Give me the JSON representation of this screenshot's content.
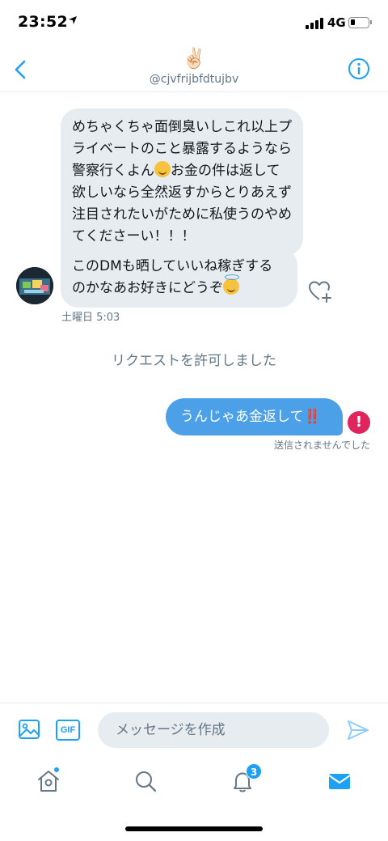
{
  "status": {
    "time": "23:52",
    "network": "4G"
  },
  "header": {
    "emoji": "✌🏻",
    "handle": "@cjvfrijbfdtujbv"
  },
  "messages": {
    "incoming_1": {
      "text_a": "めちゃくちゃ面倒臭いしこれ以上プライベートのこと暴露するようなら警察行くよん",
      "text_b": "お金の件は返して欲しいなら全然返すからとりあえず注目されたいがために私使うのやめてくださーい！！！"
    },
    "incoming_2": {
      "text": "このDMも晒していいね稼ぎするのかなあお好きにどうぞ"
    },
    "incoming_time": "土曜日 5:03",
    "system_notice": "リクエストを許可しました",
    "outgoing": {
      "text": "うんじゃあ金返して",
      "emoji": "‼️",
      "status": "送信されませんでした"
    }
  },
  "compose": {
    "gif_label": "GIF",
    "placeholder": "メッセージを作成"
  },
  "tabs": {
    "notifications_badge": "3"
  },
  "colors": {
    "accent": "#1da1f2",
    "bubble_out": "#4ba0e8",
    "bubble_in": "#e6ecf0",
    "error": "#e0245e"
  },
  "icons": [
    "back-arrow-icon",
    "info-icon",
    "heart-plus-icon",
    "error-icon",
    "image-icon",
    "gif-icon",
    "send-icon",
    "home-icon",
    "search-icon",
    "bell-icon",
    "mail-icon"
  ]
}
